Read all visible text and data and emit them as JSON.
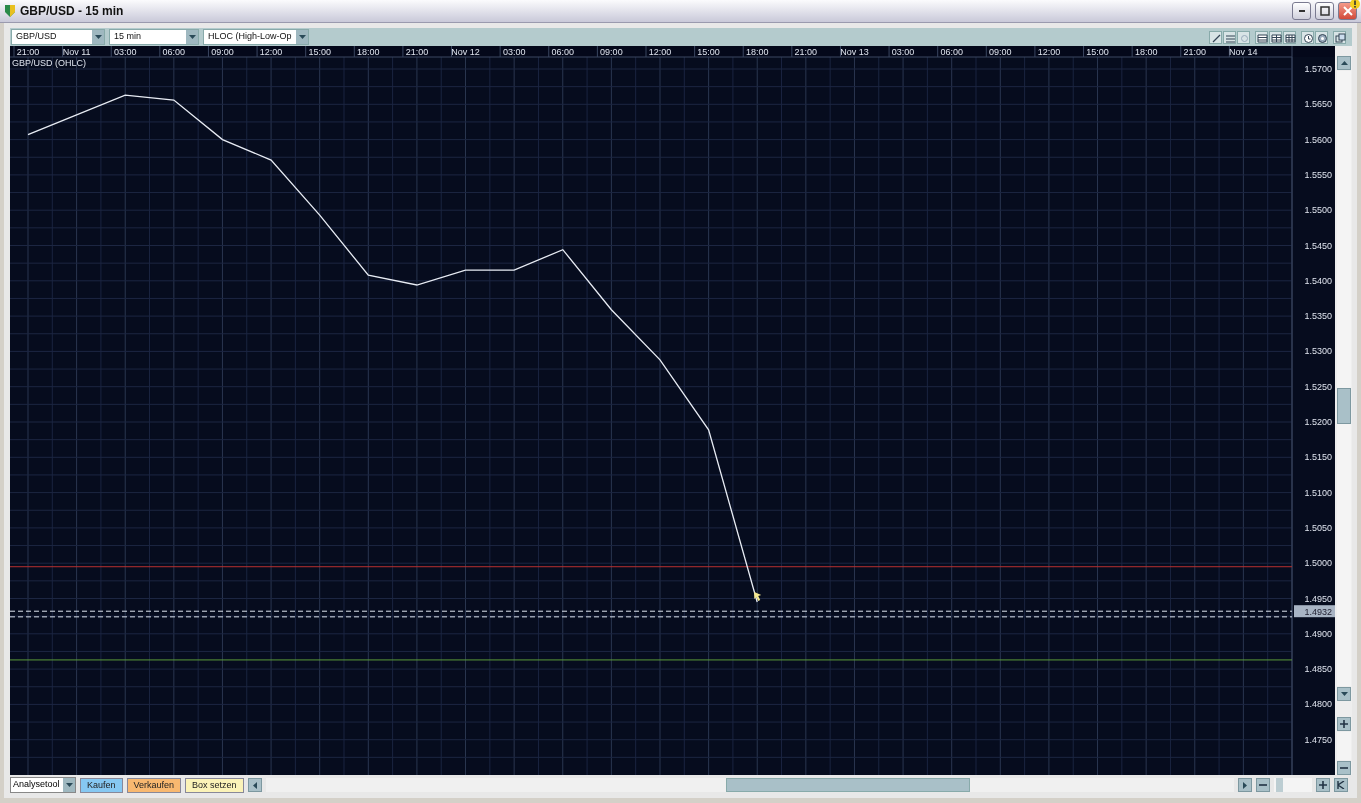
{
  "window": {
    "title": "GBP/USD - 15 min"
  },
  "toolbar": {
    "symbol": "GBP/USD",
    "interval": "15 min",
    "chart_type": "HLOC (High-Low-Op"
  },
  "chart": {
    "chart_data": {
      "type": "line",
      "title": "GBP/USD (OHLC)",
      "ylim": [
        1.47,
        1.5717
      ],
      "categories": [
        "21:00",
        "Nov 11",
        "03:00",
        "06:00",
        "09:00",
        "12:00",
        "15:00",
        "18:00",
        "21:00",
        "Nov 12",
        "03:00",
        "06:00",
        "09:00",
        "12:00",
        "15:00",
        "18:00",
        "21:00",
        "Nov 13",
        "03:00",
        "06:00",
        "09:00",
        "12:00",
        "15:00",
        "18:00",
        "21:00",
        "Nov 14"
      ],
      "series": [
        {
          "color": "#e8ecf4",
          "values": [
            1.5607,
            1.5635,
            1.5663,
            1.5656,
            1.56,
            1.5571,
            1.5493,
            1.5408,
            1.5394,
            1.5415,
            1.5415,
            1.5444,
            1.5359,
            1.5288,
            1.5189,
            1.4945,
            null,
            null,
            null,
            null,
            null,
            null,
            null,
            null,
            null,
            null
          ]
        }
      ],
      "yticks": [
        {
          "value": 1.57,
          "label": "1.5700"
        },
        {
          "value": 1.565,
          "label": "1.5650"
        },
        {
          "value": 1.56,
          "label": "1.5600"
        },
        {
          "value": 1.555,
          "label": "1.5550"
        },
        {
          "value": 1.55,
          "label": "1.5500"
        },
        {
          "value": 1.545,
          "label": "1.5450"
        },
        {
          "value": 1.54,
          "label": "1.5400"
        },
        {
          "value": 1.535,
          "label": "1.5350"
        },
        {
          "value": 1.53,
          "label": "1.5300"
        },
        {
          "value": 1.525,
          "label": "1.5250"
        },
        {
          "value": 1.52,
          "label": "1.5200"
        },
        {
          "value": 1.515,
          "label": "1.5150"
        },
        {
          "value": 1.51,
          "label": "1.5100"
        },
        {
          "value": 1.505,
          "label": "1.5050"
        },
        {
          "value": 1.5,
          "label": "1.5000"
        },
        {
          "value": 1.495,
          "label": "1.4950"
        },
        {
          "value": 1.49,
          "label": "1.4900"
        },
        {
          "value": 1.485,
          "label": "1.4850"
        },
        {
          "value": 1.48,
          "label": "1.4800"
        },
        {
          "value": 1.475,
          "label": "1.4750"
        }
      ],
      "grid": true,
      "ref_lines": [
        {
          "axis": "y",
          "value": 1.4995,
          "color": "#b83030"
        },
        {
          "axis": "y",
          "value": 1.4863,
          "color": "#5a9a3a"
        },
        {
          "axis": "y",
          "value": 1.4932,
          "color": "#dde4ee",
          "label": "1.4932"
        },
        {
          "axis": "y",
          "value": 1.4924,
          "color": "#dde4ee"
        }
      ]
    }
  },
  "bottom_bar": {
    "tool": "Analysetool",
    "buttons": [
      {
        "label": "Kaufen",
        "kind": "buy"
      },
      {
        "label": "Verkaufen",
        "kind": "sell"
      },
      {
        "label": "Box setzen",
        "kind": "box"
      }
    ]
  }
}
